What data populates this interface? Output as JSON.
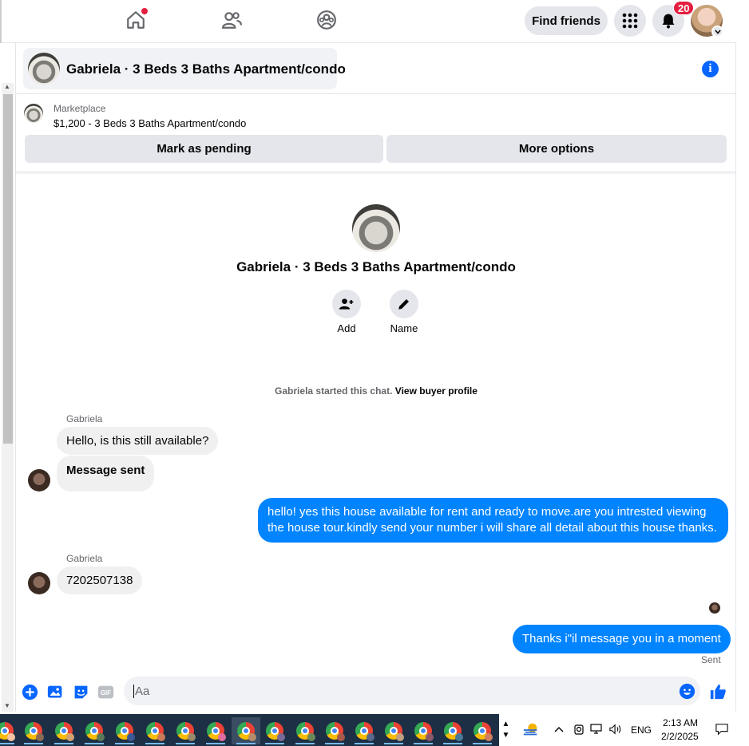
{
  "topbar": {
    "find_friends_label": "Find friends",
    "notification_count": "20"
  },
  "chat": {
    "title": "Gabriela · 3 Beds 3 Baths Apartment/condo",
    "marketplace_label": "Marketplace",
    "listing": "$1,200 - 3 Beds 3 Baths Apartment/condo",
    "mark_pending_label": "Mark as pending",
    "more_options_label": "More options",
    "profile_name": "Gabriela · 3 Beds 3 Baths Apartment/condo",
    "add_label": "Add",
    "name_label": "Name",
    "started_text": "Gabriela started this chat.",
    "view_buyer_label": "View buyer profile"
  },
  "messages": [
    {
      "sender": "Gabriela",
      "text": "Hello, is this still available?"
    },
    {
      "text": "Message sent"
    },
    {
      "text": "hello! yes this house available for rent and ready to move.are you intrested viewing the house tour.kindly send your number i will share all detail about this house thanks."
    },
    {
      "sender": "Gabriela",
      "text": "7202507138"
    },
    {
      "text": "Thanks i\"il message you in a moment",
      "status": "Sent"
    }
  ],
  "composer": {
    "placeholder": "Aa"
  },
  "taskbar": {
    "language": "ENG",
    "time": "2:13 AM",
    "date": "2/2/2025"
  },
  "colors": {
    "accent": "#0866ff",
    "outgoing_bubble": "#0084ff",
    "incoming_bubble": "#f0f0f0",
    "badge": "#e41e3f"
  }
}
